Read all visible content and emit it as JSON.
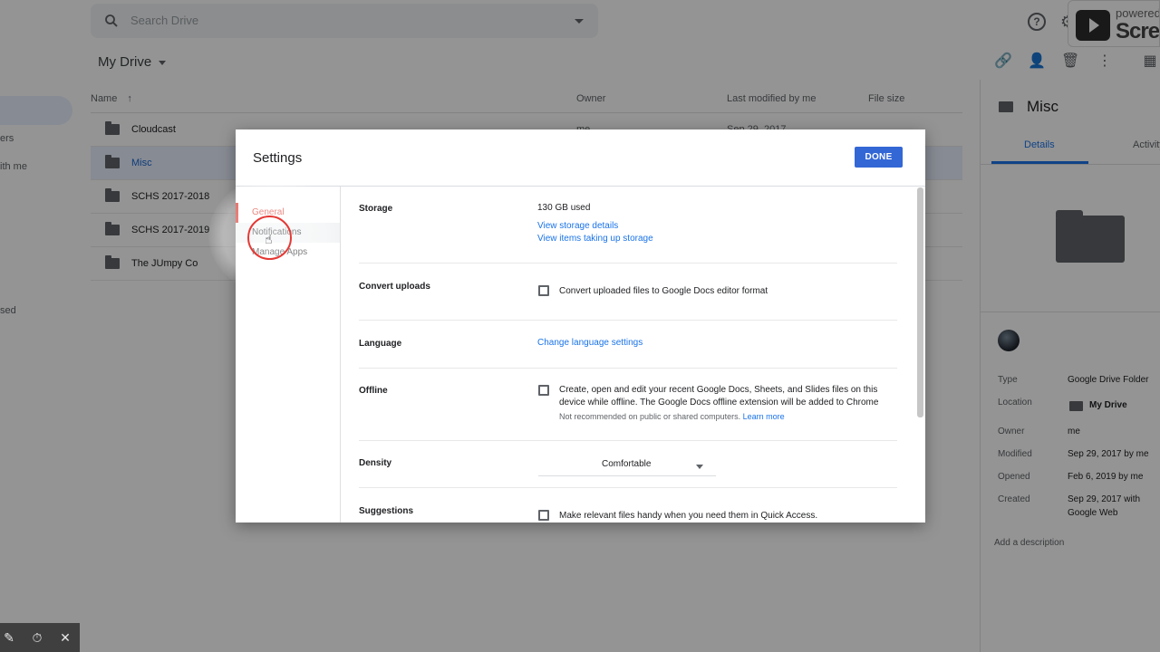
{
  "header": {
    "search_placeholder": "Search Drive",
    "watermark_line1": "powered",
    "watermark_line2": "Screen"
  },
  "breadcrumb": {
    "title": "My Drive"
  },
  "sidebar": {
    "items": [
      {
        "label": "ers"
      },
      {
        "label": "ith me"
      },
      {
        "label": "sed"
      }
    ]
  },
  "file_list": {
    "columns": {
      "name": "Name",
      "owner": "Owner",
      "modified": "Last modified by me",
      "size": "File size"
    },
    "rows": [
      {
        "name": "Cloudcast",
        "owner": "me",
        "modified": "Sep 29, 2017",
        "selected": false
      },
      {
        "name": "Misc",
        "owner": "",
        "modified": "",
        "selected": true
      },
      {
        "name": "SCHS 2017-2018",
        "owner": "",
        "modified": "",
        "selected": false
      },
      {
        "name": "SCHS 2017-2019",
        "owner": "",
        "modified": "",
        "selected": false
      },
      {
        "name": "The JUmpy Co",
        "owner": "",
        "modified": "",
        "selected": false
      }
    ]
  },
  "details_panel": {
    "title": "Misc",
    "tabs": [
      {
        "label": "Details"
      },
      {
        "label": "Activity"
      }
    ],
    "fields": [
      {
        "key": "Type",
        "value": "Google Drive Folder"
      },
      {
        "key": "Location",
        "value": "My Drive"
      },
      {
        "key": "Owner",
        "value": "me"
      },
      {
        "key": "Modified",
        "value": "Sep 29, 2017 by me"
      },
      {
        "key": "Opened",
        "value": "Feb 6, 2019 by me"
      },
      {
        "key": "Created",
        "value": "Sep 29, 2017 with Google Web"
      }
    ],
    "add_description": "Add a description"
  },
  "settings": {
    "title": "Settings",
    "done_label": "DONE",
    "nav": [
      {
        "label": "General",
        "active": true
      },
      {
        "label": "Notifications",
        "active": false
      },
      {
        "label": "Manage Apps",
        "active": false
      }
    ],
    "storage": {
      "label": "Storage",
      "used": "130 GB used",
      "link1": "View storage details",
      "link2": "View items taking up storage"
    },
    "convert": {
      "label": "Convert uploads",
      "checkbox_text": "Convert uploaded files to Google Docs editor format",
      "checked": false
    },
    "language": {
      "label": "Language",
      "link": "Change language settings"
    },
    "offline": {
      "label": "Offline",
      "checkbox_text": "Create, open and edit your recent Google Docs, Sheets, and Slides files on this device while offline. The Google Docs offline extension will be added to Chrome",
      "note": "Not recommended on public or shared computers.",
      "note_link": "Learn more",
      "checked": false
    },
    "density": {
      "label": "Density",
      "selected": "Comfortable"
    },
    "suggestions": {
      "label": "Suggestions",
      "checkbox_text": "Make relevant files handy when you need them in Quick Access.",
      "checked": false
    }
  }
}
